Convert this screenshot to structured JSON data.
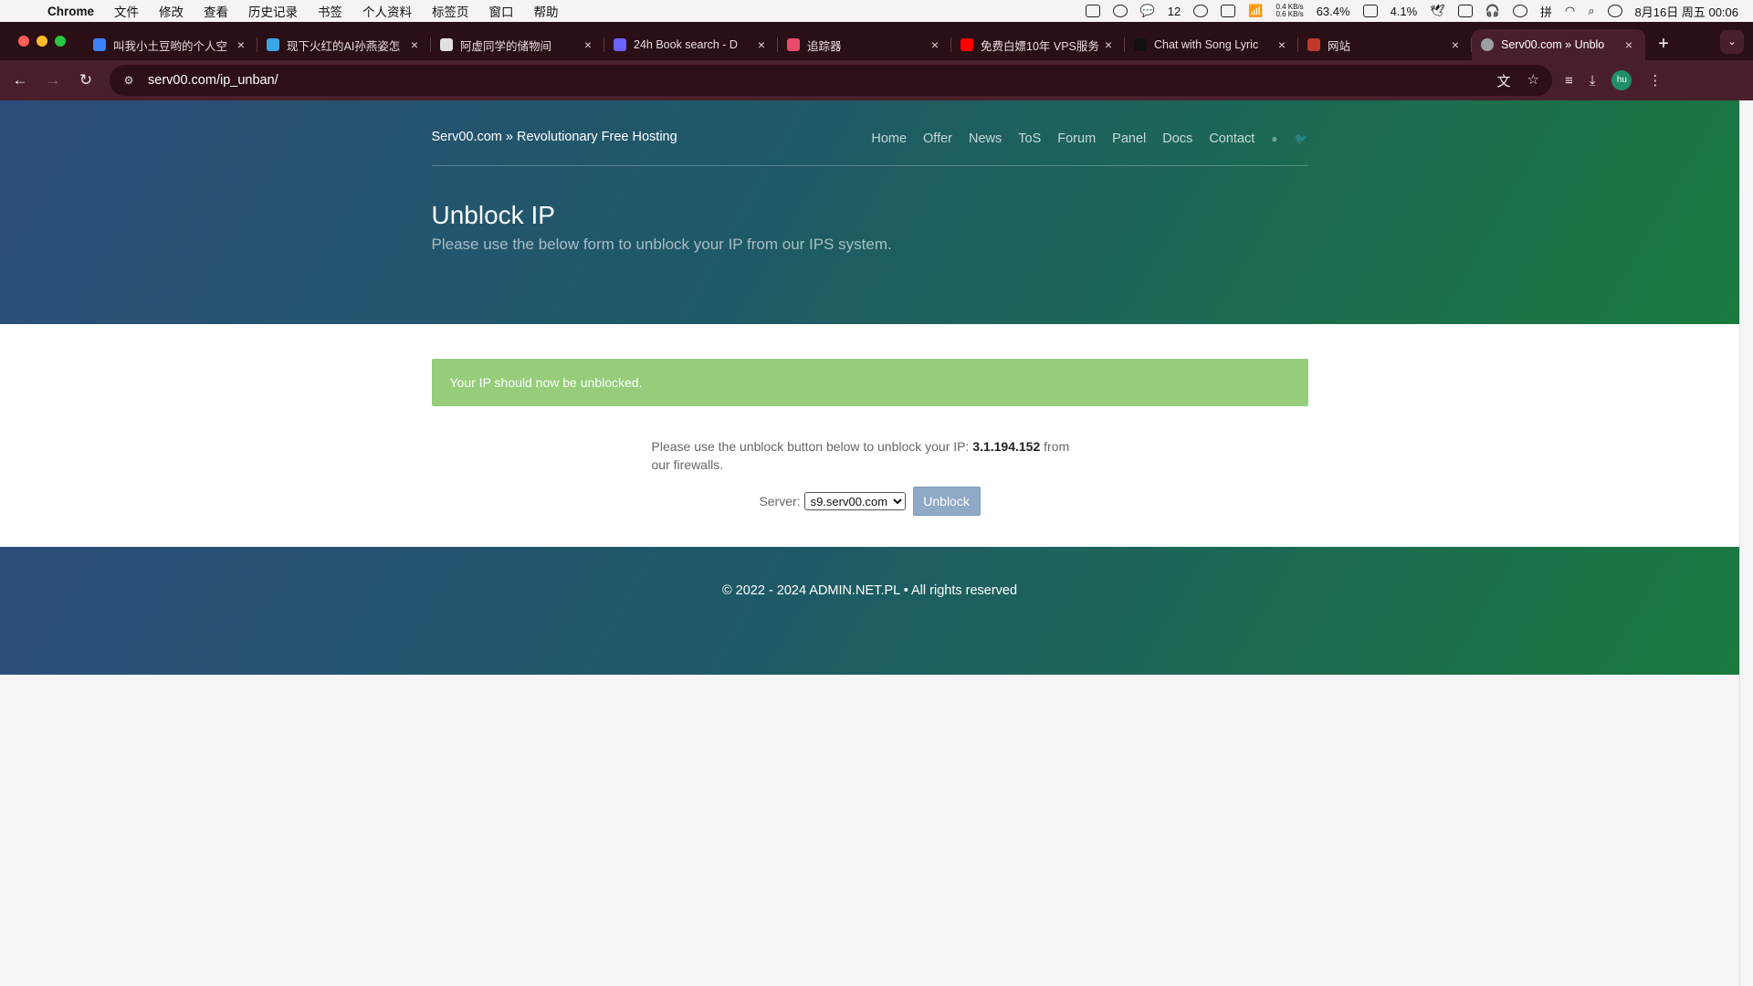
{
  "menubar": {
    "app_name": "Chrome",
    "items": [
      "文件",
      "修改",
      "查看",
      "历史记录",
      "书签",
      "个人资料",
      "标签页",
      "窗口",
      "帮助"
    ],
    "wechat_count": "12",
    "net_up": "0.4 KB/s",
    "net_down": "0.6 KB/s",
    "cpu": "63.4%",
    "mem": "4.1%",
    "clock": "8月16日 周五 00:06"
  },
  "tabs": [
    {
      "title": "叫我小土豆哟的个人空",
      "favicon_color": "#3b82f6"
    },
    {
      "title": "现下火红的AI孙燕姿怎",
      "favicon_color": "#3aa7e8"
    },
    {
      "title": "阿虚同学的储物间",
      "favicon_color": "#e0e0e0"
    },
    {
      "title": "24h Book search - D",
      "favicon_color": "#6c63ff"
    },
    {
      "title": "追踪器",
      "favicon_color": "#e84b6a"
    },
    {
      "title": "免费白嫖10年 VPS服务",
      "favicon_color": "#ff0000"
    },
    {
      "title": "Chat with Song Lyric",
      "favicon_color": "#111111"
    },
    {
      "title": "网站",
      "favicon_color": "#c0392b"
    },
    {
      "title": "Serv00.com » Unblo",
      "favicon_color": "#9aa0a6",
      "active": true
    }
  ],
  "toolbar": {
    "url": "serv00.com/ip_unban/",
    "avatar_label": "hu"
  },
  "site": {
    "brand": "Serv00.com » Revolutionary Free Hosting",
    "nav": [
      "Home",
      "Offer",
      "News",
      "ToS",
      "Forum",
      "Panel",
      "Docs",
      "Contact"
    ],
    "title": "Unblock IP",
    "subtitle": "Please use the below form to unblock your IP from our IPS system."
  },
  "alert": {
    "message": "Your IP should now be unblocked.",
    "color": "#95cd7b"
  },
  "form": {
    "info_prefix": "Please use the unblock button below to unblock your IP: ",
    "ip": "3.1.194.152",
    "info_suffix": " from our firewalls.",
    "server_label": "Server:",
    "server_value": "s9.serv00.com",
    "button_label": "Unblock"
  },
  "footer": {
    "text": "© 2022 - 2024 ADMIN.NET.PL • All rights reserved"
  }
}
